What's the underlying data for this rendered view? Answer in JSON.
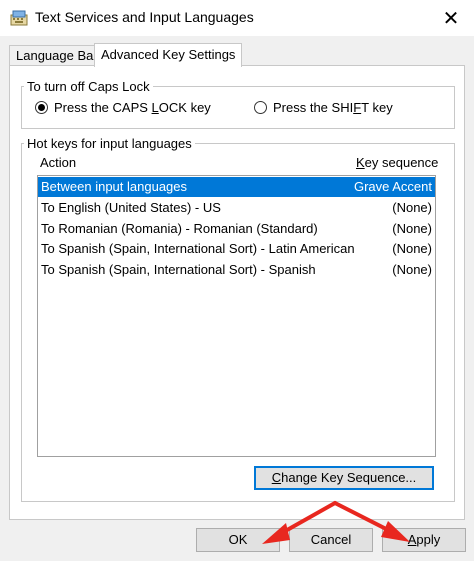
{
  "window": {
    "title": "Text Services and Input Languages",
    "close_glyph": "✕"
  },
  "tabs": [
    {
      "label": "Language Bar"
    },
    {
      "label": "Advanced Key Settings"
    }
  ],
  "caps_lock": {
    "group_label": "To turn off Caps Lock",
    "option_1_pre": "Press the CAPS ",
    "option_1_ul": "L",
    "option_1_post": "OCK key",
    "option_2_pre": "Press the SHI",
    "option_2_ul": "F",
    "option_2_post": "T key",
    "selected": "CAPS LOCK"
  },
  "hotkeys": {
    "group_label": "Hot keys for input languages",
    "col_action": "Action",
    "col_key_ul": "K",
    "col_key_rest": "ey sequence",
    "rows": [
      {
        "action": "Between input languages",
        "key": "Grave Accent"
      },
      {
        "action": "To English (United States) - US",
        "key": "(None)"
      },
      {
        "action": "To Romanian (Romania) - Romanian (Standard)",
        "key": "(None)"
      },
      {
        "action": "To Spanish (Spain, International Sort) - Latin American",
        "key": "(None)"
      },
      {
        "action": "To Spanish (Spain, International Sort) - Spanish",
        "key": "(None)"
      }
    ],
    "change_btn_ul": "C",
    "change_btn_rest": "hange Key Sequence..."
  },
  "footer": {
    "ok": "OK",
    "cancel": "Cancel",
    "apply_ul": "A",
    "apply_rest": "pply"
  },
  "colors": {
    "selection": "#0078d7",
    "annotation_arrow": "#e8271f"
  }
}
